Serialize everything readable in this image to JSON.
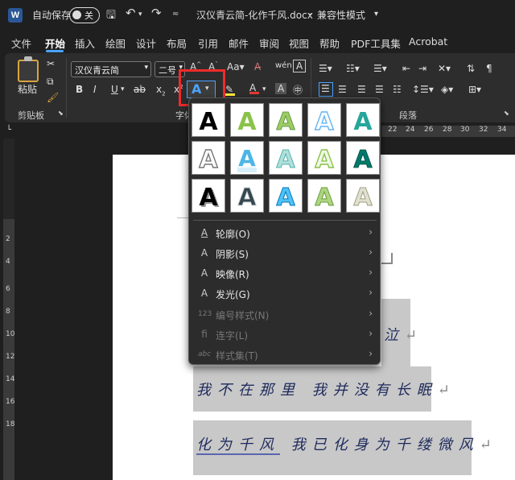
{
  "titlebar": {
    "autosave_label": "自动保存",
    "toggle_state": "关",
    "filename": "汉仪青云简-化作千风.docx",
    "separator": "-",
    "mode": "兼容性模式"
  },
  "tabs": [
    "文件",
    "开始",
    "插入",
    "绘图",
    "设计",
    "布局",
    "引用",
    "邮件",
    "审阅",
    "视图",
    "帮助",
    "PDF工具集",
    "Acrobat"
  ],
  "ribbon": {
    "paste_label": "粘贴",
    "clipboard_label": "剪贴板",
    "font_name": "汉仪青云简",
    "font_size": "二号",
    "font_group_label": "字体",
    "paragraph_group_label": "段落",
    "font_buttons": [
      "B",
      "I",
      "U",
      "ab",
      "x",
      "x"
    ]
  },
  "ruler": {
    "numbers": [
      "22",
      "24",
      "26",
      "28",
      "30",
      "32",
      "34"
    ]
  },
  "vruler": {
    "numbers": [
      "2",
      "4",
      "6",
      "8",
      "10",
      "12",
      "14",
      "16",
      "18"
    ]
  },
  "dropdown": {
    "menu": [
      {
        "label": "轮廓(O)",
        "icon": "A",
        "enabled": true
      },
      {
        "label": "阴影(S)",
        "icon": "A",
        "enabled": true
      },
      {
        "label": "映像(R)",
        "icon": "A",
        "enabled": true
      },
      {
        "label": "发光(G)",
        "icon": "A",
        "enabled": true
      },
      {
        "label": "编号样式(N)",
        "icon": "123",
        "enabled": false
      },
      {
        "label": "连字(L)",
        "icon": "fi",
        "enabled": false
      },
      {
        "label": "样式集(T)",
        "icon": "abc",
        "enabled": false
      }
    ]
  },
  "document": {
    "line1_tail": "泣",
    "line2": "我不在那里  我并没有长眠",
    "line3a": "化为千风",
    "line3b": "  我已化身为千缕微风"
  },
  "colors": {
    "accent": "#4aa3ff",
    "highlight_box": "#ef2b2b",
    "doc_text": "#1e2a5c"
  }
}
